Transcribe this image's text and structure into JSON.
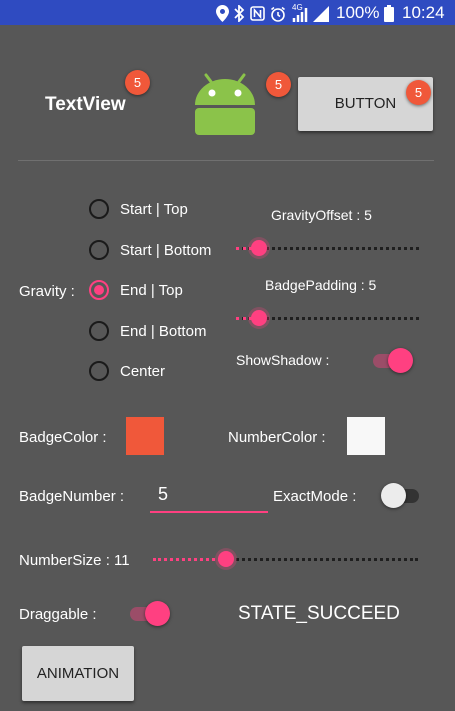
{
  "status_bar": {
    "battery": "100%",
    "time": "10:24",
    "network": "4G"
  },
  "header": {
    "textview_label": "TextView",
    "textview_badge": "5",
    "android_badge": "5",
    "button_label": "BUTTON",
    "button_badge": "5"
  },
  "gravity": {
    "label": "Gravity :",
    "options": [
      "Start | Top",
      "Start | Bottom",
      "End | Top",
      "End | Bottom",
      "Center"
    ],
    "selected": "End | Top"
  },
  "gravity_offset": {
    "label": "GravityOffset : 5",
    "value": 5,
    "max": 40
  },
  "badge_padding": {
    "label": "BadgePadding : 5",
    "value": 5,
    "max": 40
  },
  "show_shadow": {
    "label": "ShowShadow :",
    "on": true
  },
  "badge_color": {
    "label": "BadgeColor :",
    "color": "#f0583a"
  },
  "number_color": {
    "label": "NumberColor :",
    "color": "#f8f8f8"
  },
  "badge_number": {
    "label": "BadgeNumber :",
    "value": "5"
  },
  "exact_mode": {
    "label": "ExactMode :",
    "on": false
  },
  "number_size": {
    "label": "NumberSize : 11",
    "value": 11,
    "max": 40
  },
  "draggable": {
    "label": "Draggable :",
    "on": true
  },
  "state_text": "STATE_SUCCEED",
  "animation_button": {
    "label": "ANIMATION"
  },
  "colors": {
    "accent": "#ff4081",
    "status_bar": "#2f4bc1",
    "android_green": "#8bc34a",
    "background": "#575757"
  }
}
